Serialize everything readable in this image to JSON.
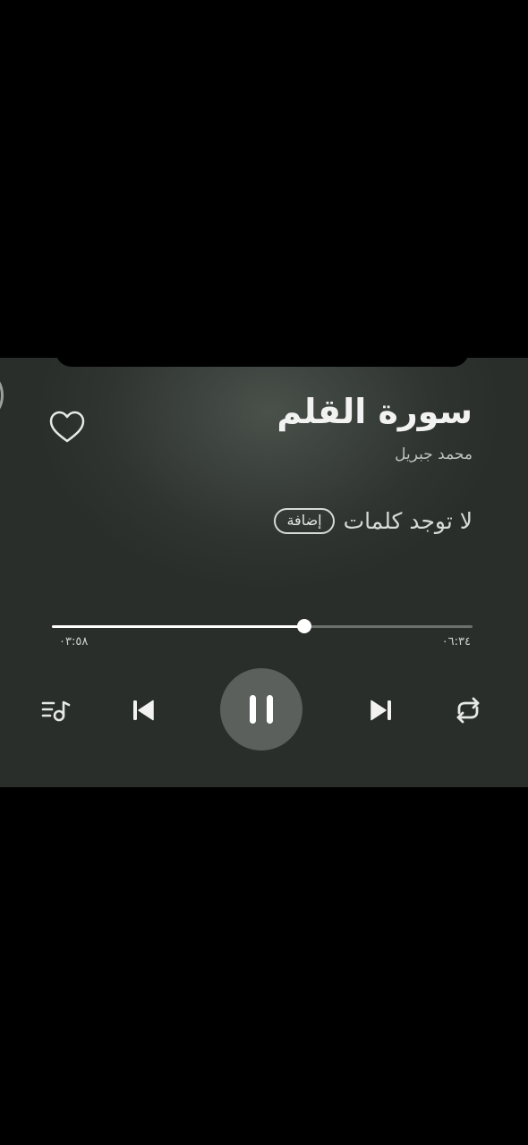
{
  "track": {
    "title": "سورة القلم",
    "artist": "محمد جبريل",
    "liked": false
  },
  "lyrics": {
    "message": "لا توجد كلمات",
    "add_label": "إضافة"
  },
  "playback": {
    "elapsed": "٠٣:٥٨",
    "total": "٠٦:٣٤",
    "progress_fraction": 0.6,
    "state": "playing"
  },
  "controls": {
    "queue_icon": "queue-music-icon",
    "previous_icon": "skip-previous-icon",
    "pause_icon": "pause-icon",
    "next_icon": "skip-next-icon",
    "repeat_icon": "repeat-icon"
  },
  "colors": {
    "background": "#2f3430",
    "accent": "#ffffff",
    "play_button": "#5b605c"
  }
}
